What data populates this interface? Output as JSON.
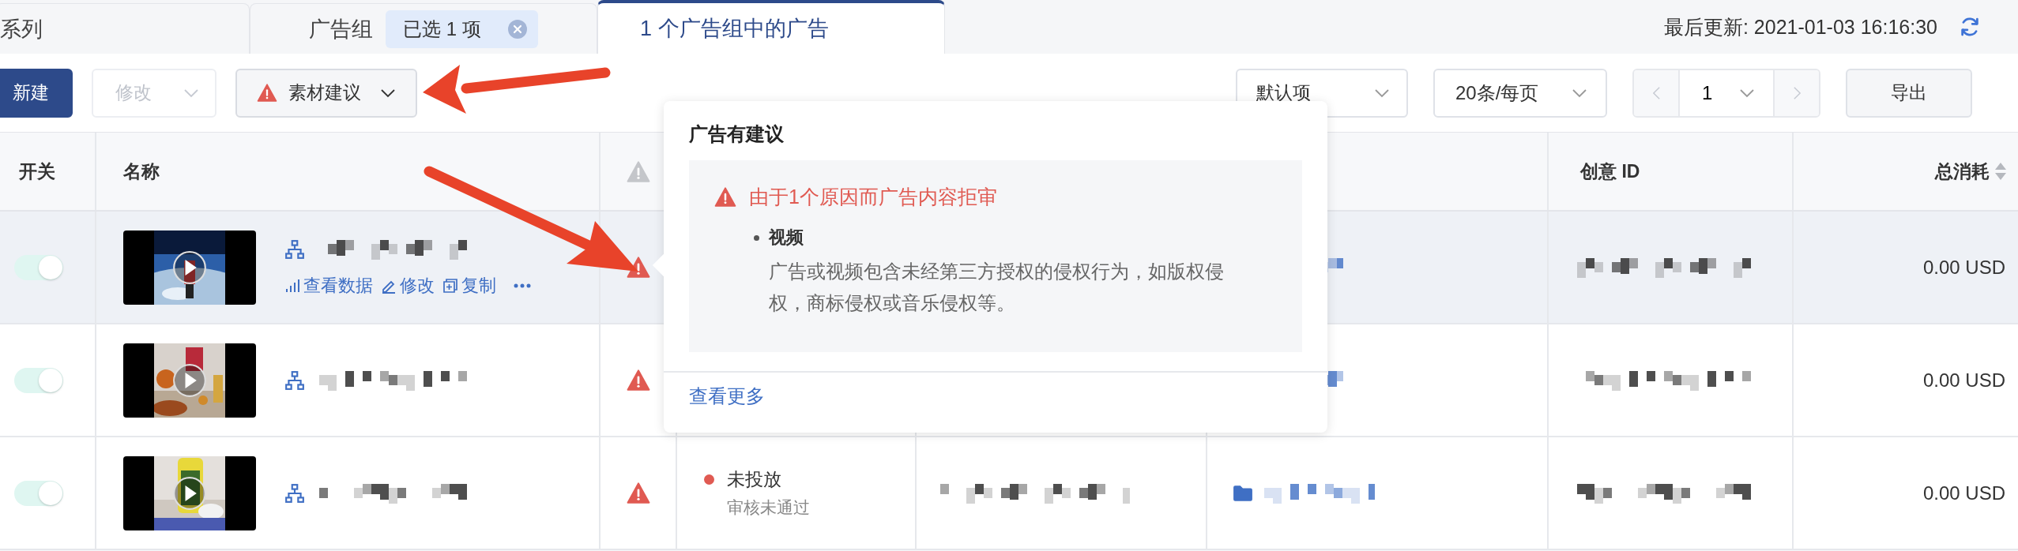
{
  "tabs": [
    {
      "label": "系列",
      "selected": false
    },
    {
      "label": "广告组",
      "selected": false,
      "chip": "已选 1 项"
    },
    {
      "label": "1 个广告组中的广告",
      "selected": true
    }
  ],
  "last_updated": "最后更新: 2021-01-03 16:16:30",
  "toolbar": {
    "buttons": [
      {
        "label": "新建",
        "kind": "primary",
        "disabled": false
      },
      {
        "label": "修改",
        "kind": "dropdown",
        "disabled": true
      },
      {
        "label": "素材建议",
        "kind": "warning-dropdown",
        "disabled": false
      }
    ],
    "sort": "默认项",
    "page_size": "20条/每页",
    "page": "1",
    "export": "导出"
  },
  "table": {
    "columns": [
      {
        "kind": "text",
        "label": "开关"
      },
      {
        "kind": "text",
        "label": "名称"
      },
      {
        "kind": "warning"
      },
      {
        "kind": "text",
        "label": "创意 ID"
      },
      {
        "kind": "sortable",
        "label": "总消耗"
      }
    ],
    "rows": [
      {
        "selected": true,
        "on": true,
        "warning": true,
        "actions": [
          {
            "kind": "stats",
            "label": "查看数据"
          },
          {
            "kind": "edit",
            "label": "修改"
          },
          {
            "kind": "copy",
            "label": "复制"
          },
          {
            "kind": "more"
          }
        ],
        "spend": "0.00 USD"
      },
      {
        "selected": false,
        "on": true,
        "warning": true,
        "spend": "0.00 USD"
      },
      {
        "selected": false,
        "on": true,
        "warning": true,
        "status": {
          "label": "未投放",
          "detail": "审核未通过",
          "color": "#e05a52"
        },
        "spend": "0.00 USD"
      }
    ]
  },
  "popover": {
    "title": "广告有建议",
    "reason": "由于1个原因而广告内容拒审",
    "items": [
      {
        "label": "视频",
        "description": "广告或视频包含未经第三方授权的侵权行为，如版权侵权，商标侵权或音乐侵权等。"
      }
    ],
    "link": "查看更多"
  }
}
